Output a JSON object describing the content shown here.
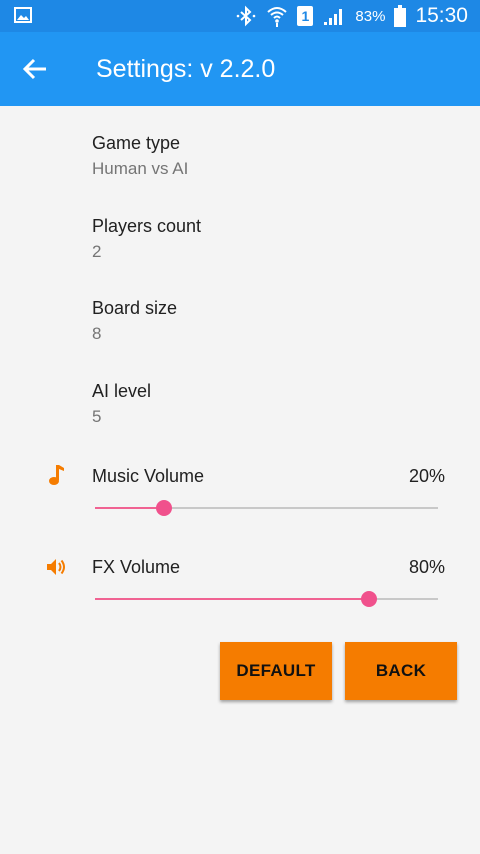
{
  "status_bar": {
    "time": "15:30",
    "battery": "83%",
    "sim": "1",
    "icons": [
      "gallery-icon",
      "bluetooth-icon",
      "wifi-icon",
      "sim-icon",
      "signal-icon",
      "battery-icon"
    ]
  },
  "app_bar": {
    "title": "Settings: v 2.2.0",
    "color": "#2196f3",
    "icon": "back-arrow-icon"
  },
  "preferences": [
    {
      "title": "Game type",
      "summary": "Human vs AI"
    },
    {
      "title": "Players count",
      "summary": "2"
    },
    {
      "title": "Board size",
      "summary": "8"
    },
    {
      "title": "AI level",
      "summary": "5"
    }
  ],
  "sliders": {
    "music": {
      "label": "Music Volume",
      "value_text": "20%",
      "value": 20,
      "icon": "music-note-icon"
    },
    "fx": {
      "label": "FX Volume",
      "value_text": "80%",
      "value": 80,
      "icon": "speaker-icon"
    }
  },
  "buttons": {
    "default": "DEFAULT",
    "back": "BACK"
  },
  "colors": {
    "accent": "#f57c00",
    "slider": "#f06292",
    "status_bar": "#1e88e5"
  }
}
